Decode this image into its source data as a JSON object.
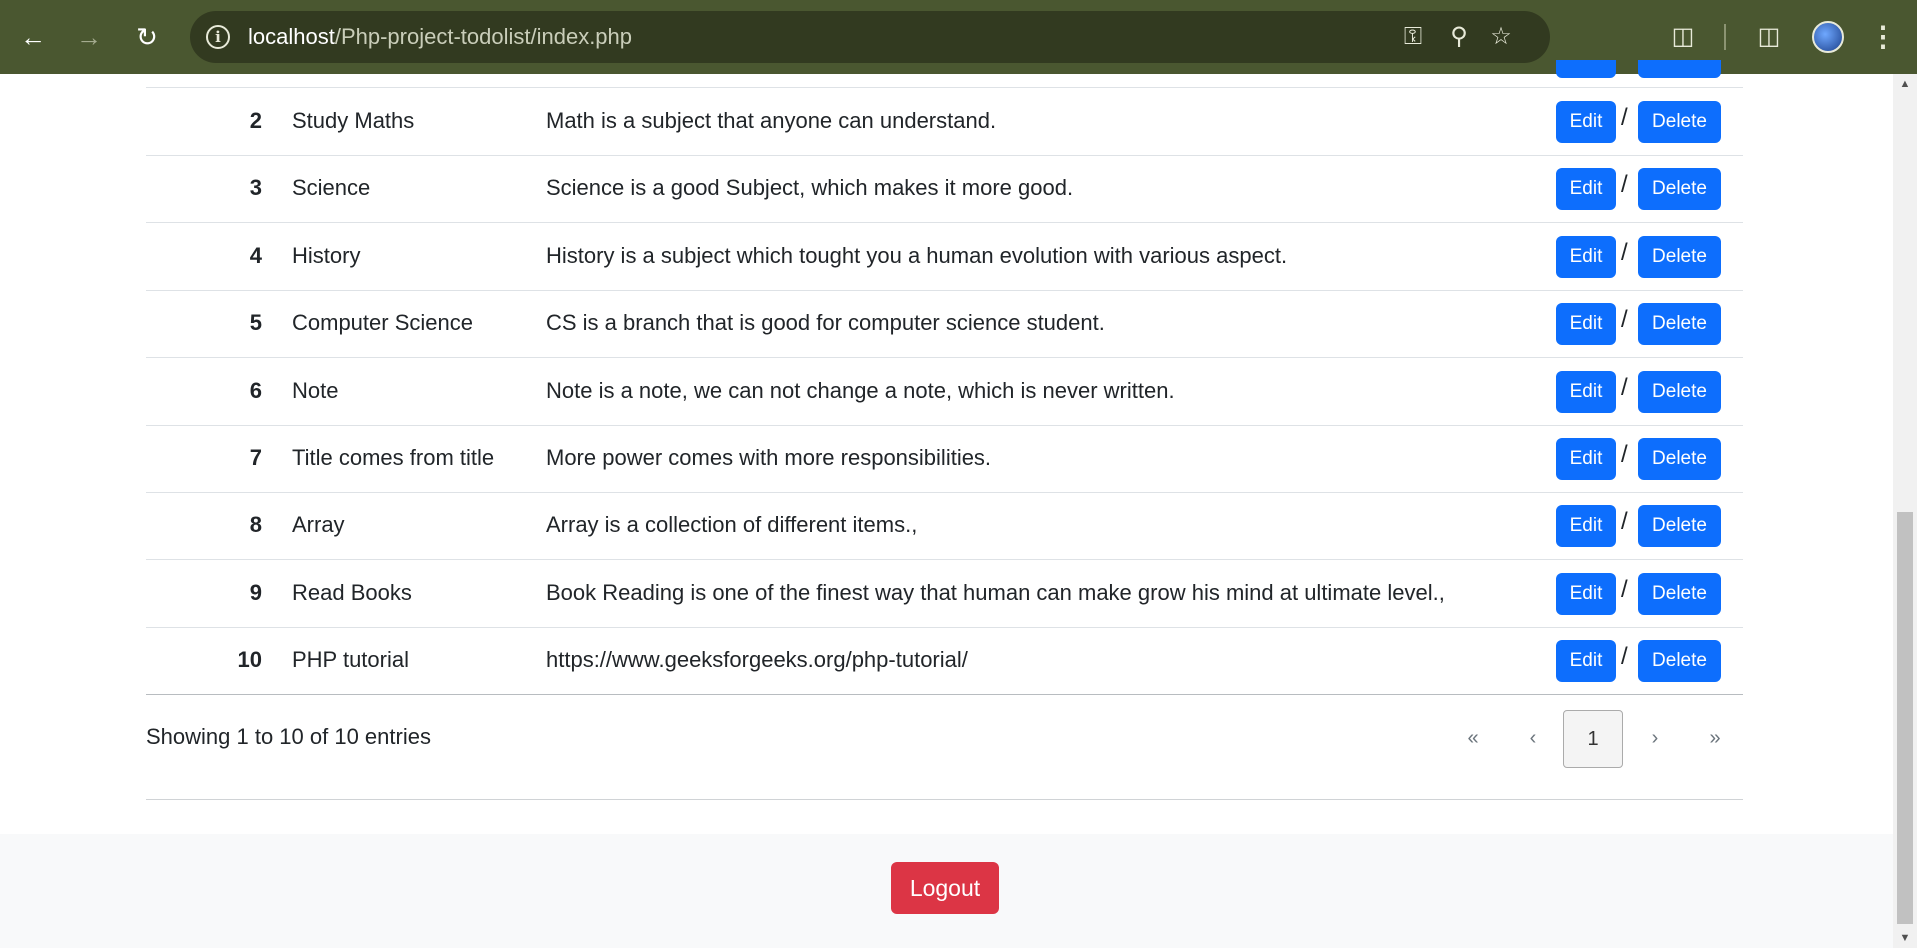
{
  "browser": {
    "url_host": "localhost",
    "url_path": "/Php-project-todolist/index.php"
  },
  "table": {
    "rows": [
      {
        "num": "2",
        "title": "Study Maths",
        "desc": "Math is a subject that anyone can understand."
      },
      {
        "num": "3",
        "title": "Science",
        "desc": "Science is a good Subject, which makes it more good."
      },
      {
        "num": "4",
        "title": "History",
        "desc": "History is a subject which tought you a human evolution with various aspect."
      },
      {
        "num": "5",
        "title": "Computer Science",
        "desc": "CS is a branch that is good for computer science student."
      },
      {
        "num": "6",
        "title": "Note",
        "desc": "Note is a note, we can not change a note, which is never written."
      },
      {
        "num": "7",
        "title": "Title comes from title",
        "desc": "More power comes with more responsibilities."
      },
      {
        "num": "8",
        "title": "Array",
        "desc": "Array is a collection of different items.,"
      },
      {
        "num": "9",
        "title": "Read Books",
        "desc": "Book Reading is one of the finest way that human can make grow his mind at ultimate level.,"
      },
      {
        "num": "10",
        "title": "PHP tutorial",
        "desc": "https://www.geeksforgeeks.org/php-tutorial/"
      }
    ],
    "edit_label": "Edit",
    "delete_label": "Delete",
    "separator": "/"
  },
  "footer_info": "Showing 1 to 10 of 10 entries",
  "pagination": {
    "first": "«",
    "prev": "‹",
    "current": "1",
    "next": "›",
    "last": "»"
  },
  "logout_label": "Logout",
  "colors": {
    "primary": "#0d6efd",
    "danger": "#dc3545",
    "chrome": "#4a5730"
  }
}
